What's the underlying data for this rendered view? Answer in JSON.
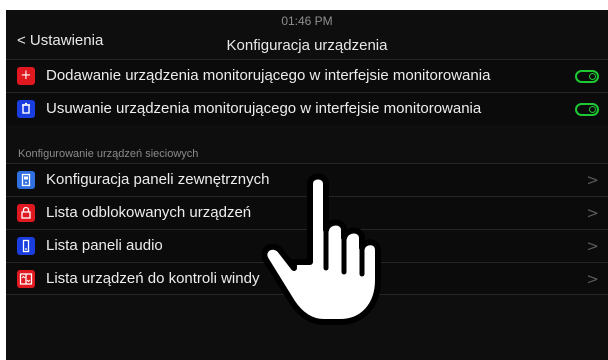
{
  "status_bar": {
    "time": "01:46 PM"
  },
  "header": {
    "back_label": "< Ustawienia",
    "title": "Konfiguracja urządzenia"
  },
  "toggles": [
    {
      "label": "Dodawanie urządzenia monitorującego w interfejsie monitorowania",
      "icon": "plus-icon",
      "icon_color": "#e0181f",
      "state": "on"
    },
    {
      "label": "Usuwanie urządzenia monitorującego w interfejsie monitorowania",
      "icon": "trash-icon",
      "icon_color": "#1a3de0",
      "state": "on"
    }
  ],
  "section": {
    "label": "Konfigurowanie urządzeń sieciowych"
  },
  "items": [
    {
      "label": "Konfiguracja paneli zewnętrznych",
      "icon": "door-panel-icon",
      "icon_color": "#2f6fe0",
      "chevron": ">"
    },
    {
      "label": "Lista odblokowanych urządzeń",
      "icon": "lock-icon",
      "icon_color": "#e0181f",
      "chevron": ">"
    },
    {
      "label": "Lista paneli audio",
      "icon": "audio-panel-icon",
      "icon_color": "#1a3de0",
      "chevron": ">"
    },
    {
      "label": "Lista urządzeń do kontroli windy",
      "icon": "elevator-icon",
      "icon_color": "#e0181f",
      "chevron": ">"
    }
  ],
  "colors": {
    "toggle_on": "#1ec832",
    "background": "#0e0e0e"
  }
}
